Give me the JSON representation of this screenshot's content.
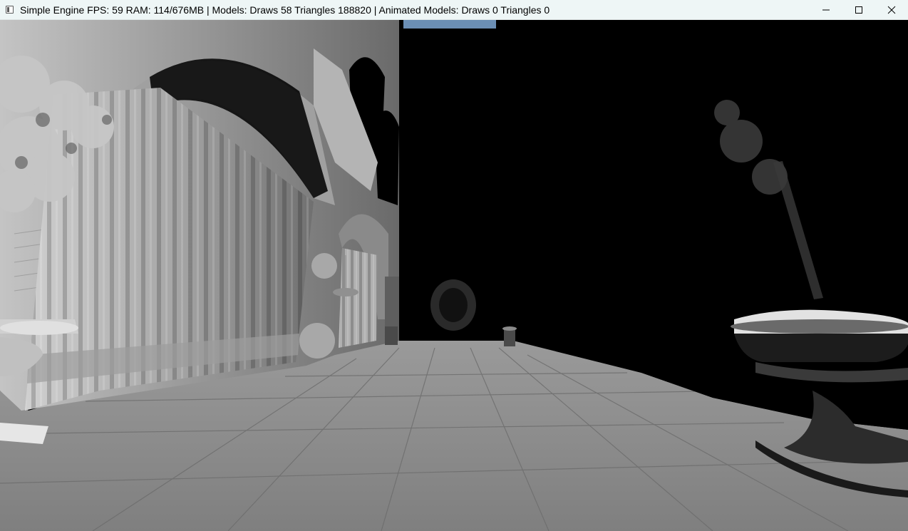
{
  "window": {
    "title": "Simple Engine FPS: 59 RAM: 114/676MB | Models: Draws 58 Triangles 188820 | Animated Models: Draws 0 Triangles 0",
    "icon": "app-window-icon",
    "controls": {
      "minimize_icon": "minimize-icon",
      "maximize_icon": "maximize-icon",
      "close_icon": "close-icon"
    }
  },
  "scene": {
    "description_visible_text": "",
    "sky_color": "#6b8fb5",
    "floor_color": "#8e8e8e",
    "wall_light_color": "#b8b8b8",
    "shadow_color": "#000000"
  }
}
